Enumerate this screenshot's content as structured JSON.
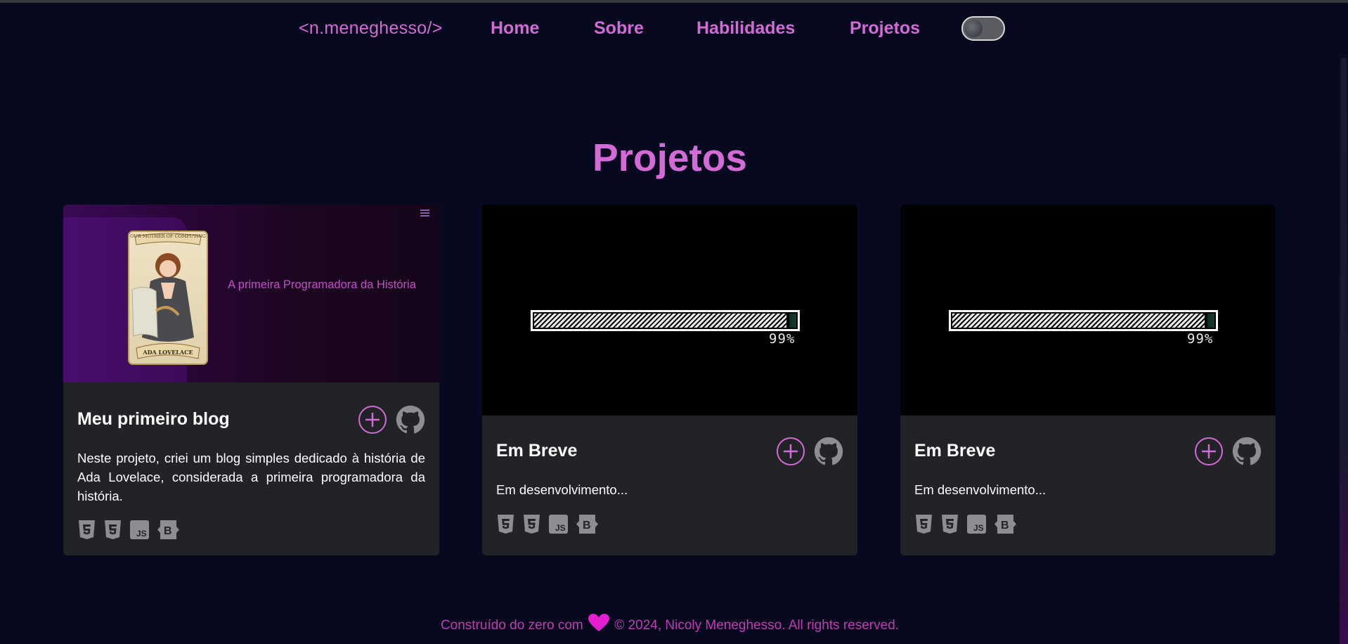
{
  "nav": {
    "logo": "<n.meneghesso/>",
    "links": [
      "Home",
      "Sobre",
      "Habilidades",
      "Projetos"
    ],
    "theme_toggle_icon": "moon-icon"
  },
  "section": {
    "title": "Projetos"
  },
  "projects": [
    {
      "image_caption": "A primeira Programadora da História",
      "image_card_text_top": "OUR MOTHER OF COMPUTING",
      "image_card_text_bottom": "ADA LOVELACE",
      "title": "Meu primeiro blog",
      "description": "Neste projeto, criei um blog simples dedicado à história de Ada Lovelace, considerada a primeira programadora da história.",
      "techs": [
        "html5-icon",
        "css3-icon",
        "javascript-icon",
        "bootstrap-icon"
      ]
    },
    {
      "progress_label": "99%",
      "progress": 0.99,
      "title": "Em Breve",
      "description": "Em desenvolvimento...",
      "techs": [
        "html5-icon",
        "css3-icon",
        "javascript-icon",
        "bootstrap-icon"
      ]
    },
    {
      "progress_label": "99%",
      "progress": 0.99,
      "title": "Em Breve",
      "description": "Em desenvolvimento...",
      "techs": [
        "html5-icon",
        "css3-icon",
        "javascript-icon",
        "bootstrap-icon"
      ]
    }
  ],
  "footer": {
    "prefix": "Construído do zero com",
    "suffix": "© 2024, Nicoly Meneghesso. All rights reserved."
  },
  "colors": {
    "accent": "#d36ad6",
    "footer": "#c43bb6",
    "background": "#070a1e",
    "card": "#212327"
  }
}
